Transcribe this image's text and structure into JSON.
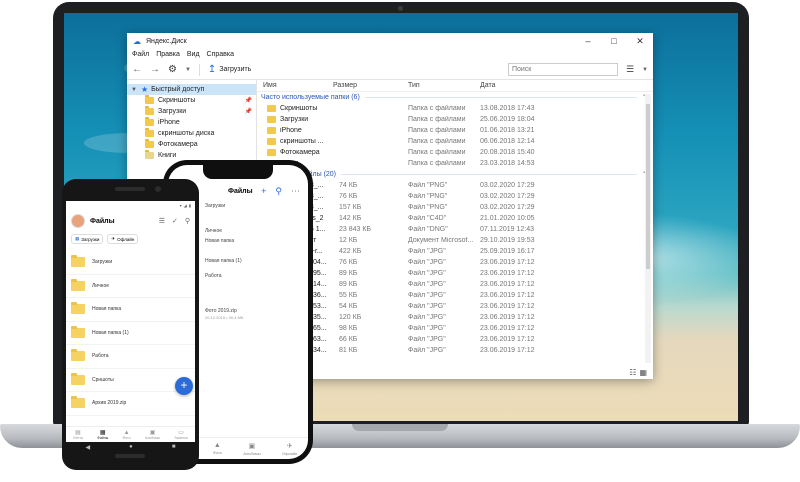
{
  "explorer": {
    "title": "Яндекс.Диск",
    "menu": [
      "Файл",
      "Правка",
      "Вид",
      "Справка"
    ],
    "toolbar": {
      "upload_label": "Загрузить",
      "search_placeholder": "Поиск"
    },
    "nav": {
      "quick_access": "Быстрый доступ",
      "items": [
        "Скриншоты",
        "Загрузки",
        "iPhone",
        "скриншоты диска",
        "Фотокамера",
        "Книги"
      ]
    },
    "columns": {
      "name": "Имя",
      "size": "Размер",
      "type": "Тип",
      "date": "Дата"
    },
    "frequent": {
      "title": "Часто используемые папки (6)",
      "rows": [
        {
          "name": "Скриншоты",
          "type": "Папка с файлами",
          "date": "13.08.2018 17:43"
        },
        {
          "name": "Загрузки",
          "type": "Папка с файлами",
          "date": "25.06.2019 18:04"
        },
        {
          "name": "iPhone",
          "type": "Папка с файлами",
          "date": "01.06.2018 13:21"
        },
        {
          "name": "скриншоты ...",
          "type": "Папка с файлами",
          "date": "06.06.2018 12:14"
        },
        {
          "name": "Фотокамера",
          "type": "Папка с файлами",
          "date": "20.08.2018 15:40"
        },
        {
          "name": "Книги",
          "type": "Папка с файлами",
          "date": "23.03.2018 14:53"
        }
      ]
    },
    "recent": {
      "title": "Последние файлы (20)",
      "rows": [
        {
          "name": "2020-02-03_...",
          "size": "74 КБ",
          "type": "Файл \"PNG\"",
          "date": "03.02.2020 17:29"
        },
        {
          "name": "2020-02-03_...",
          "size": "76 КБ",
          "type": "Файл \"PNG\"",
          "date": "03.02.2020 17:29"
        },
        {
          "name": "2020-02-03_...",
          "size": "157 КБ",
          "type": "Файл \"PNG\"",
          "date": "03.02.2020 17:29"
        },
        {
          "name": "shader_less_2",
          "size": "142 КБ",
          "type": "Файл \"C4D\"",
          "date": "21.01.2020 10:05"
        },
        {
          "name": "2019-10-25 1...",
          "size": "23 843 КБ",
          "type": "Файл \"DNG\"",
          "date": "07.11.2019 12:43"
        },
        {
          "name": "11Документ",
          "size": "12 КБ",
          "type": "Документ Microsof...",
          "date": "29.10.2019 19:53"
        },
        {
          "name": "cat-favorite-r...",
          "size": "422 КБ",
          "type": "Файл \"JPG\"",
          "date": "25.09.2019 16:17"
        },
        {
          "name": "94141882104...",
          "size": "76 КБ",
          "type": "Файл \"JPG\"",
          "date": "23.06.2019 17:12"
        },
        {
          "name": "94126250695...",
          "size": "89 КБ",
          "type": "Файл \"JPG\"",
          "date": "23.06.2019 17:12"
        },
        {
          "name": "93707484214...",
          "size": "89 КБ",
          "type": "Файл \"JPG\"",
          "date": "23.06.2019 17:12"
        },
        {
          "name": "16520843236...",
          "size": "55 КБ",
          "type": "Файл \"JPG\"",
          "date": "23.06.2019 17:12"
        },
        {
          "name": "16484759153...",
          "size": "54 КБ",
          "type": "Файл \"JPG\"",
          "date": "23.06.2019 17:12"
        },
        {
          "name": "16430916135...",
          "size": "120 КБ",
          "type": "Файл \"JPG\"",
          "date": "23.06.2019 17:12"
        },
        {
          "name": "16427567065...",
          "size": "98 КБ",
          "type": "Файл \"JPG\"",
          "date": "23.06.2019 17:12"
        },
        {
          "name": "16422569463...",
          "size": "66 КБ",
          "type": "Файл \"JPG\"",
          "date": "23.06.2019 17:12"
        },
        {
          "name": "16422694434...",
          "size": "81 КБ",
          "type": "Файл \"JPG\"",
          "date": "23.06.2019 17:12"
        }
      ]
    }
  },
  "iphone": {
    "title": "Файлы",
    "rows": [
      "Загрузки",
      "Личное",
      "Новая папка",
      "Новая папка (1)",
      "Работа",
      "Фото 2019.zip",
      "20.12.2019 • 30,4 МБ"
    ],
    "tabs": [
      "Файлы",
      "Фото",
      "Альбомы",
      "Офлайн"
    ]
  },
  "android": {
    "title": "Файлы",
    "chips": [
      "Загрузки",
      "Офлайн"
    ],
    "items": [
      "Загрузки",
      "Личное",
      "Новая папка",
      "Новая папка (1)",
      "Работа",
      "Срншоты",
      "Архив 2019.zip"
    ],
    "tabs": [
      "Лента",
      "Файлы",
      "Фото",
      "Альбомы",
      "Заметки"
    ]
  }
}
